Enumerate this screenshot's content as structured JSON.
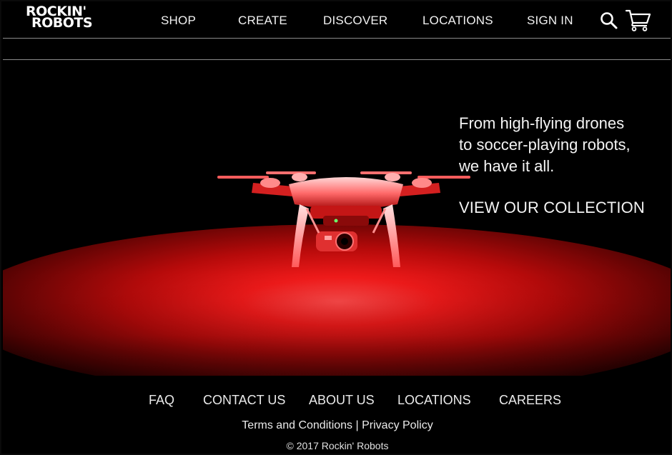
{
  "brand": {
    "line1": "ROCKIN'",
    "line2": "ROBOTS"
  },
  "nav": {
    "items": [
      {
        "label": "SHOP"
      },
      {
        "label": "CREATE"
      },
      {
        "label": "DISCOVER"
      },
      {
        "label": "LOCATIONS"
      },
      {
        "label": "SIGN IN"
      }
    ],
    "icons": [
      "search-icon",
      "cart-icon"
    ]
  },
  "hero": {
    "tagline_lines": [
      "From high-flying drones",
      "to soccer-playing robots,",
      "we have it all."
    ],
    "cta_label": "VIEW OUR COLLECTION",
    "accent_color": "#ff2a2a"
  },
  "footer": {
    "links": [
      {
        "label": "FAQ"
      },
      {
        "label": "CONTACT US"
      },
      {
        "label": "ABOUT US"
      },
      {
        "label": "LOCATIONS"
      },
      {
        "label": "CAREERS"
      }
    ],
    "terms_label": "Terms and Conditions",
    "separator": "|",
    "privacy_label": "Privacy Policy",
    "copyright": "© 2017 Rockin' Robots"
  }
}
